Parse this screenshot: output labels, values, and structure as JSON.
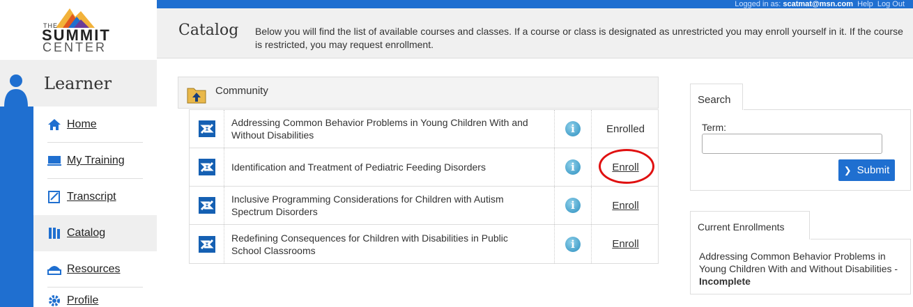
{
  "brand": {
    "the": "THE",
    "summit": "SUMMIT",
    "center": "CENTER"
  },
  "section": {
    "label": "Learner"
  },
  "nav": [
    {
      "label": "Home",
      "icon": "home-icon"
    },
    {
      "label": "My Training",
      "icon": "monitor-icon"
    },
    {
      "label": "Transcript",
      "icon": "transcript-icon"
    },
    {
      "label": "Catalog",
      "icon": "catalog-icon"
    },
    {
      "label": "Resources",
      "icon": "resources-icon"
    },
    {
      "label": "Profile",
      "icon": "gear-icon"
    }
  ],
  "topbar": {
    "prefix": "Logged in as: ",
    "user": "scatmat@msn.com",
    "help": "Help",
    "logout": "Log Out"
  },
  "header": {
    "title": "Catalog",
    "description": "Below you will find the list of available courses and classes. If a course or class is designated as unrestricted you may enroll yourself in it. If the course is restricted, you may request enrollment."
  },
  "catalog": {
    "group": "Community",
    "courses": [
      {
        "title": "Addressing Common Behavior Problems in Young Children With and Without Disabilities",
        "status": "Enrolled",
        "action": false
      },
      {
        "title": "Identification and Treatment of Pediatric Feeding Disorders",
        "status": "Enroll",
        "action": true
      },
      {
        "title": "Inclusive Programming Considerations for Children with Autism Spectrum Disorders",
        "status": "Enroll",
        "action": true
      },
      {
        "title": "Redefining Consequences for Children with Disabilities in Public School Classrooms",
        "status": "Enroll",
        "action": true
      }
    ]
  },
  "search": {
    "tab": "Search",
    "term_label": "Term:",
    "term_value": "",
    "submit": "Submit"
  },
  "enrollments": {
    "tab": "Current Enrollments",
    "item": "Addressing Common Behavior Problems in Young Children With and Without Disabilities - ",
    "status": "Incomplete"
  },
  "colors": {
    "primary": "#1f6fd0",
    "highlight": "#e01010"
  }
}
